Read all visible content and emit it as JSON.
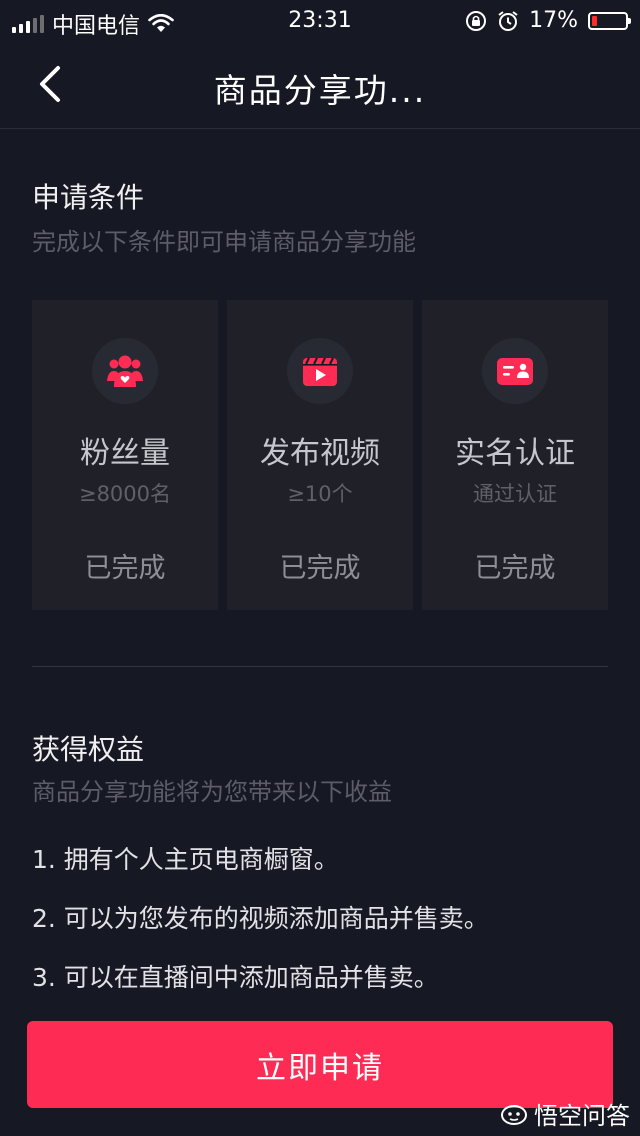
{
  "status_bar": {
    "carrier": "中国电信",
    "time": "23:31",
    "battery_percent": "17%",
    "battery_level": 0.17,
    "icons": [
      "signal-icon",
      "wifi-icon",
      "rotation-lock-icon",
      "alarm-icon",
      "battery-icon"
    ]
  },
  "nav": {
    "title": "商品分享功...",
    "back_icon": "chevron-left-icon"
  },
  "conditions": {
    "title": "申请条件",
    "subtitle": "完成以下条件即可申请商品分享功能",
    "cards": [
      {
        "icon": "fans-icon",
        "title": "粉丝量",
        "requirement": "≥8000名",
        "status": "已完成"
      },
      {
        "icon": "video-icon",
        "title": "发布视频",
        "requirement": "≥10个",
        "status": "已完成"
      },
      {
        "icon": "id-card-icon",
        "title": "实名认证",
        "requirement": "通过认证",
        "status": "已完成"
      }
    ]
  },
  "benefits": {
    "title": "获得权益",
    "subtitle": "商品分享功能将为您带来以下收益",
    "items": [
      "1. 拥有个人主页电商橱窗。",
      "2. 可以为您发布的视频添加商品并售卖。",
      "3. 可以在直播间中添加商品并售卖。"
    ]
  },
  "apply_button": {
    "label": "立即申请"
  },
  "watermark": {
    "text": "悟空问答"
  },
  "colors": {
    "accent": "#fe2c55",
    "background": "#161823",
    "card": "#1f2028",
    "icon": "#fe2c55"
  }
}
